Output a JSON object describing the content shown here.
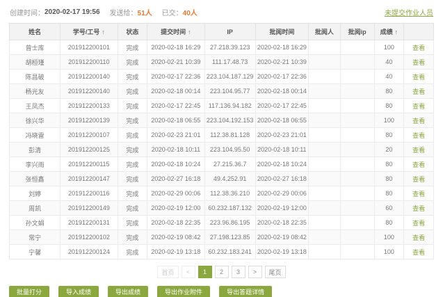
{
  "topbar": {
    "created_label": "创建时间：",
    "created_value": "2020-02-17 19:56",
    "sent_label": "发送给：",
    "sent_value": "51人",
    "submitted_label": "已交：",
    "submitted_value": "40人",
    "unsubmitted_link": "未提交作业人员"
  },
  "colors": {
    "accent": "#8ba83e",
    "orange": "#e8782f"
  },
  "table": {
    "columns": [
      {
        "label": "姓名",
        "sortable": false
      },
      {
        "label": "学号/工号",
        "sortable": true
      },
      {
        "label": "状态",
        "sortable": false
      },
      {
        "label": "提交时间",
        "sortable": true
      },
      {
        "label": "IP",
        "sortable": false
      },
      {
        "label": "批阅时间",
        "sortable": false
      },
      {
        "label": "批阅人",
        "sortable": false
      },
      {
        "label": "批阅ip",
        "sortable": false
      },
      {
        "label": "成绩",
        "sortable": true
      },
      {
        "label": "",
        "sortable": false
      }
    ],
    "sort_icon": "↑",
    "view_label": "查看",
    "rows": [
      {
        "name": "曾士库",
        "id": "201912200101",
        "status": "完成",
        "submit_time": "2020-02-18 16:29",
        "ip": "27.218.39.123",
        "review_time": "2020-02-18 16:29",
        "reviewer": "",
        "review_ip": "",
        "score": "100"
      },
      {
        "name": "胡桓瑾",
        "id": "201912200110",
        "status": "完成",
        "submit_time": "2020-02-21 10:39",
        "ip": "111.17.48.73",
        "review_time": "2020-02-21 10:39",
        "reviewer": "",
        "review_ip": "",
        "score": "40"
      },
      {
        "name": "陈昌破",
        "id": "201912200140",
        "status": "完成",
        "submit_time": "2020-02-17 22:36",
        "ip": "223.104.187.129",
        "review_time": "2020-02-17 22:36",
        "reviewer": "",
        "review_ip": "",
        "score": "40"
      },
      {
        "name": "杨光友",
        "id": "201912200140",
        "status": "完成",
        "submit_time": "2020-02-18 00:14",
        "ip": "223.104.95.77",
        "review_time": "2020-02-18 00:14",
        "reviewer": "",
        "review_ip": "",
        "score": "80"
      },
      {
        "name": "王凤杰",
        "id": "201912200133",
        "status": "完成",
        "submit_time": "2020-02-17 22:45",
        "ip": "117.136.94.182",
        "review_time": "2020-02-17 22:45",
        "reviewer": "",
        "review_ip": "",
        "score": "80"
      },
      {
        "name": "徐兴华",
        "id": "201912200139",
        "status": "完成",
        "submit_time": "2020-02-18 06:55",
        "ip": "223.104.192.153",
        "review_time": "2020-02-18 06:55",
        "reviewer": "",
        "review_ip": "",
        "score": "100"
      },
      {
        "name": "冯晓雷",
        "id": "201912200107",
        "status": "完成",
        "submit_time": "2020-02-23 21:01",
        "ip": "112.38.81.128",
        "review_time": "2020-02-23 21:01",
        "reviewer": "",
        "review_ip": "",
        "score": "80"
      },
      {
        "name": "彭清",
        "id": "201912200125",
        "status": "完成",
        "submit_time": "2020-02-18 10:11",
        "ip": "223.104.95.50",
        "review_time": "2020-02-18 10:11",
        "reviewer": "",
        "review_ip": "",
        "score": "20"
      },
      {
        "name": "李兴雨",
        "id": "201912200115",
        "status": "完成",
        "submit_time": "2020-02-18 10:24",
        "ip": "27.215.36.7",
        "review_time": "2020-02-18 10:24",
        "reviewer": "",
        "review_ip": "",
        "score": "80"
      },
      {
        "name": "张恒鑫",
        "id": "201912200147",
        "status": "完成",
        "submit_time": "2020-02-27 16:18",
        "ip": "49.4.252.91",
        "review_time": "2020-02-27 16:18",
        "reviewer": "",
        "review_ip": "",
        "score": "80"
      },
      {
        "name": "刘婷",
        "id": "201912200116",
        "status": "完成",
        "submit_time": "2020-02-29 00:06",
        "ip": "112.38.36.210",
        "review_time": "2020-02-29 00:06",
        "reviewer": "",
        "review_ip": "",
        "score": "80"
      },
      {
        "name": "周凯",
        "id": "201912200149",
        "status": "完成",
        "submit_time": "2020-02-19 12:00",
        "ip": "60.232.187.132",
        "review_time": "2020-02-19 12:00",
        "reviewer": "",
        "review_ip": "",
        "score": "60"
      },
      {
        "name": "孙文娟",
        "id": "201912200131",
        "status": "完成",
        "submit_time": "2020-02-18 22:35",
        "ip": "223.96.86.195",
        "review_time": "2020-02-18 22:35",
        "reviewer": "",
        "review_ip": "",
        "score": "80"
      },
      {
        "name": "常宁",
        "id": "201912200102",
        "status": "完成",
        "submit_time": "2020-02-19 08:42",
        "ip": "27.198.123.85",
        "review_time": "2020-02-19 08:42",
        "reviewer": "",
        "review_ip": "",
        "score": "100"
      },
      {
        "name": "宁馨",
        "id": "201912200124",
        "status": "完成",
        "submit_time": "2020-02-19 13:18",
        "ip": "60.232.183.241",
        "review_time": "2020-02-19 13:18",
        "reviewer": "",
        "review_ip": "",
        "score": "100"
      }
    ]
  },
  "pagination": {
    "items": [
      {
        "label": "首页",
        "state": "disabled"
      },
      {
        "label": "<",
        "state": "disabled"
      },
      {
        "label": "1",
        "state": "active"
      },
      {
        "label": "2",
        "state": "normal"
      },
      {
        "label": "3",
        "state": "normal"
      },
      {
        "label": ">",
        "state": "normal"
      },
      {
        "label": "尾页",
        "state": "normal"
      }
    ]
  },
  "footer_buttons": [
    {
      "label": "批量打分"
    },
    {
      "label": "导入成绩"
    },
    {
      "label": "导出成绩"
    },
    {
      "label": "导出作业附件"
    },
    {
      "label": "导出答题详情"
    }
  ]
}
